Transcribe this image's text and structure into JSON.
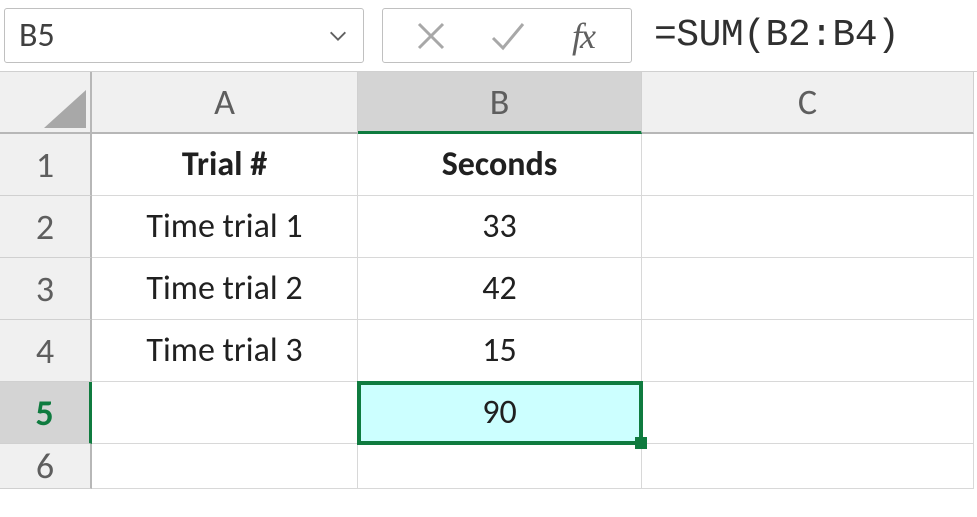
{
  "name_box": {
    "value": "B5"
  },
  "formula_bar": {
    "content": "=SUM(B2:B4)"
  },
  "columns": {
    "a": "A",
    "b": "B",
    "c": "C"
  },
  "rows": {
    "r1": "1",
    "r2": "2",
    "r3": "3",
    "r4": "4",
    "r5": "5",
    "r6": "6"
  },
  "cells": {
    "a1": "Trial #",
    "b1": "Seconds",
    "a2": "Time trial 1",
    "b2": "33",
    "a3": "Time trial 2",
    "b3": "42",
    "a4": "Time trial 3",
    "b4": "15",
    "b5": "90"
  },
  "chart_data": {
    "type": "table",
    "title": "",
    "columns": [
      "Trial #",
      "Seconds"
    ],
    "rows": [
      [
        "Time trial 1",
        33
      ],
      [
        "Time trial 2",
        42
      ],
      [
        "Time trial 3",
        15
      ]
    ],
    "sum_seconds": 90,
    "formula": "=SUM(B2:B4)"
  }
}
